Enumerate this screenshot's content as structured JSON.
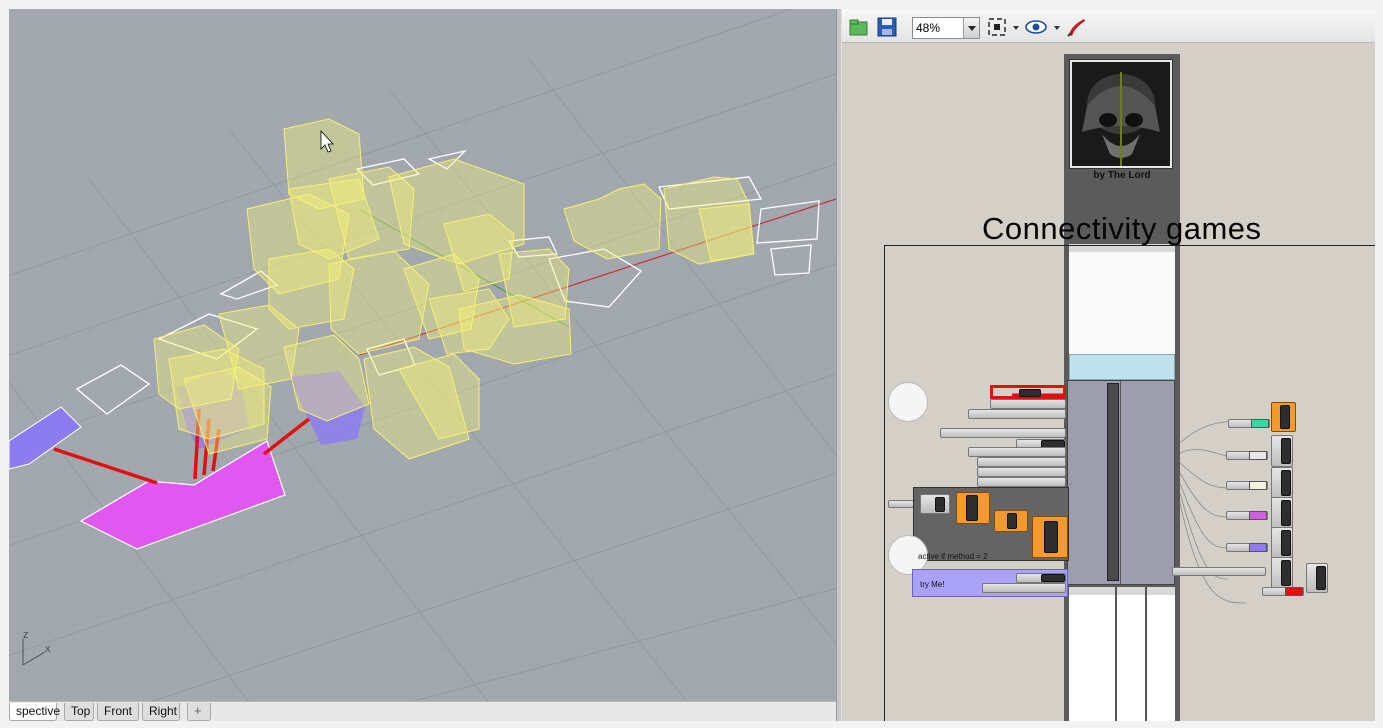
{
  "viewport": {
    "axis_z": "z",
    "axis_x": "x",
    "tabs": [
      {
        "label": "spective",
        "active": true
      },
      {
        "label": "Top",
        "active": false
      },
      {
        "label": "Front",
        "active": false
      },
      {
        "label": "Right",
        "active": false
      }
    ],
    "add_tab_glyph": "+"
  },
  "grasshopper": {
    "zoom_value": "48%",
    "icons": [
      "open-file-icon",
      "save-file-icon",
      "zoom-extents-icon",
      "preview-eye-icon",
      "sketch-brush-icon"
    ],
    "author_caption": "by The Lord",
    "canvas_title": "Connectivity games",
    "group_note": "active if method = 2",
    "button_label": "try Me!",
    "colors": {
      "canvas": "#d4d0c8",
      "group_dark": "#646464",
      "group_purple": "#a9a2f7",
      "component_orange": "#f29a2e",
      "viewport_bg": "#a3a8af",
      "wire_red": "#e01010",
      "box_yellow": "#f5f27a",
      "region_magenta": "#e058f0",
      "region_violet": "#8d7cf0"
    }
  }
}
